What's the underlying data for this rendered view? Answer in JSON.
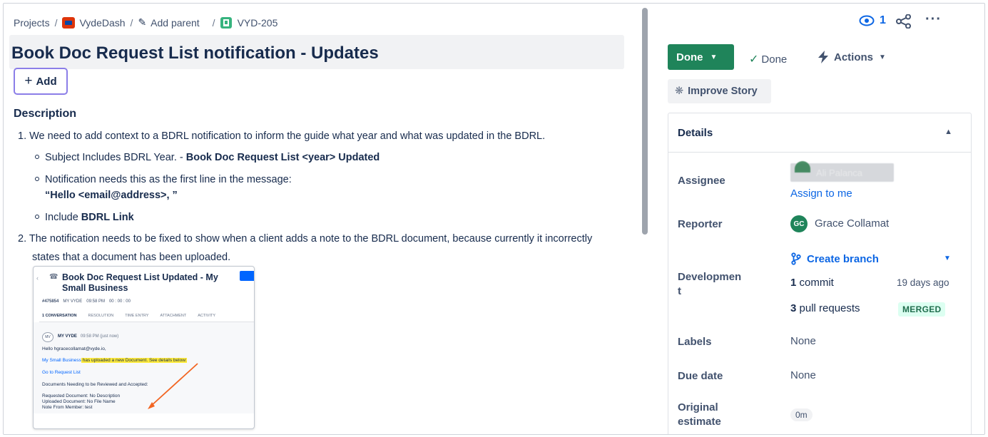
{
  "breadcrumb": {
    "projects": "Projects",
    "project": "VydeDash",
    "add_parent": "Add parent",
    "issue_key": "VYD-205"
  },
  "issue": {
    "title": "Book Doc Request List notification - Updates",
    "add_label": "Add"
  },
  "description": {
    "heading": "Description",
    "item1": "1. We need to add context to a BDRL notification to inform the guide what year and what was updated in the BDRL.",
    "sub1_prefix": "Subject Includes BDRL Year. - ",
    "sub1_bold": "Book Doc Request List <year> Updated",
    "sub2": "Notification needs this as the first line in the message:",
    "sub2_quote": "“Hello <email@address>, ”",
    "sub3_prefix": "Include ",
    "sub3_bold": "BDRL Link",
    "item2_line1": "2. The notification needs to be fixed to show when a client adds a note to the BDRL document, because currently it incorrectly",
    "item2_line2": "states that a document has been uploaded."
  },
  "thumbnail": {
    "title": "Book Doc Request List Updated - My Small Business",
    "ticket": "#475854",
    "company": "MY VYDE",
    "time": "09:58 PM",
    "timer": "00 : 00 : 00",
    "tabs": [
      "1 CONVERSATION",
      "RESOLUTION",
      "TIME ENTRY",
      "ATTACHMENT",
      "ACTIVITY"
    ],
    "avatar": "MV",
    "sender": "MY VYDE",
    "sent_time": "09:58 PM (just now)",
    "greeting": "Hello hgracecollamat@vyde.io,",
    "business": "My Small Business",
    "uploaded": " has uploaded a new Document. See details below:",
    "request_link": "Go to Request List",
    "needing": "Documents Needing to be Reviewed and Accepted:",
    "requested": "Requested Document: No Description",
    "uploaded_doc": "Uploaded Document: No File Name",
    "note": "Note From Member: test"
  },
  "toolbar": {
    "watch_count": "1"
  },
  "status": {
    "button": "Done",
    "resolution": "Done",
    "actions": "Actions",
    "improve": "Improve Story"
  },
  "details": {
    "heading": "Details",
    "assignee_label": "Assignee",
    "assignee_name": "Ali Palanca",
    "assign_to_me": "Assign to me",
    "reporter_label": "Reporter",
    "reporter_initials": "GC",
    "reporter_name": "Grace Collamat",
    "development_label_1": "Developmen",
    "development_label_2": "t",
    "create_branch": "Create branch",
    "commit_count": "1",
    "commit_label": " commit",
    "commit_time": "19 days ago",
    "pr_count": "3",
    "pr_label": " pull requests",
    "merged": "MERGED",
    "labels_label": "Labels",
    "labels_value": "None",
    "due_label": "Due date",
    "due_value": "None",
    "estimate_label_1": "Original",
    "estimate_label_2": "estimate",
    "estimate_value": "0m"
  },
  "colors": {
    "done_green": "#1f845a",
    "link_blue": "#0c66e4",
    "merged_bg": "#dcfff1",
    "add_border": "#8b7ee8"
  }
}
